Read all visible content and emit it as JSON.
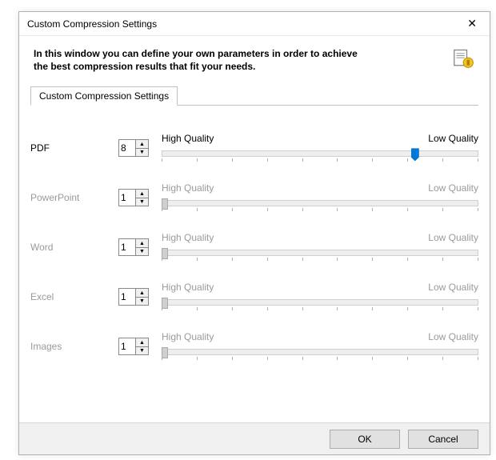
{
  "window": {
    "title": "Custom Compression Settings",
    "close_icon": "✕"
  },
  "intro": {
    "line1": "In this window you can define your own parameters in order to achieve",
    "line2": "the best compression results that fit your needs."
  },
  "tabs": {
    "active": "Custom Compression Settings"
  },
  "labels": {
    "high_quality": "High Quality",
    "low_quality": "Low Quality"
  },
  "rows": [
    {
      "label": "PDF",
      "value": "8",
      "enabled": true,
      "thumb_position_pct": 80
    },
    {
      "label": "PowerPoint",
      "value": "1",
      "enabled": false,
      "thumb_position_pct": 0
    },
    {
      "label": "Word",
      "value": "1",
      "enabled": false,
      "thumb_position_pct": 0
    },
    {
      "label": "Excel",
      "value": "1",
      "enabled": false,
      "thumb_position_pct": 0
    },
    {
      "label": "Images",
      "value": "1",
      "enabled": false,
      "thumb_position_pct": 0
    }
  ],
  "buttons": {
    "ok": "OK",
    "cancel": "Cancel"
  },
  "slider": {
    "ticks": 10
  }
}
